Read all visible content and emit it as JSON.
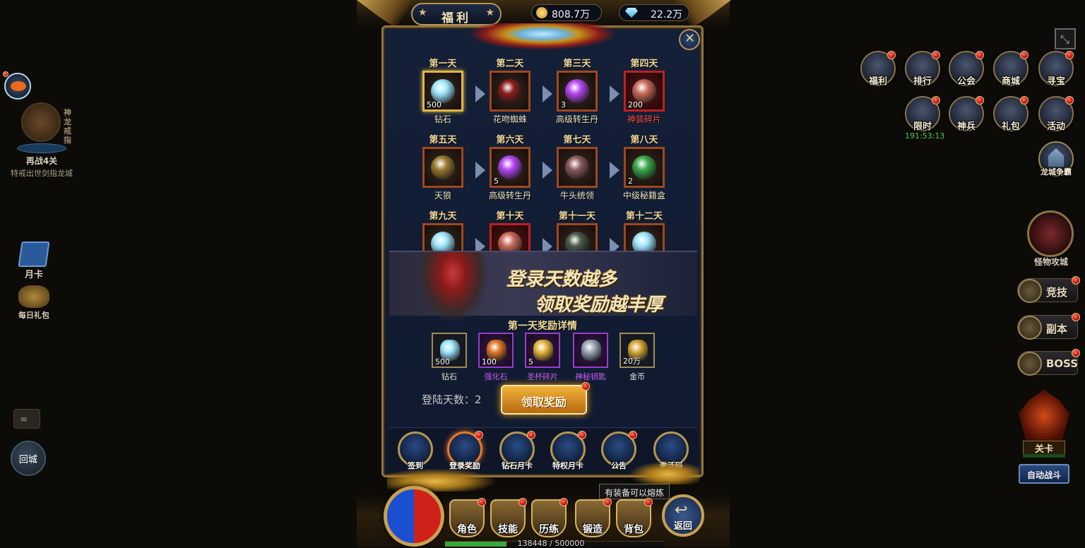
{
  "topbar": {
    "title": "福利",
    "gold": "808.7万",
    "diamonds": "22.2万"
  },
  "left": {
    "boss_side_text": "神龙戒指",
    "boss_level": "再战4关",
    "boss_hint": "特戒出世剑指龙城",
    "month_card": "月卡",
    "daily_gift": "每日礼包",
    "return_city": "回城"
  },
  "right": {
    "row1": [
      "福利",
      "排行",
      "公会",
      "商城",
      "寻宝"
    ],
    "row2": [
      "限时",
      "神兵",
      "礼包",
      "活动"
    ],
    "timer": "191:53:13",
    "dragon_war": "龙城争霸",
    "monster_siege": "怪物攻城",
    "arena": "竞技",
    "dungeon": "副本",
    "boss": "BOSS",
    "stage": "关卡",
    "auto_battle": "自动战斗"
  },
  "days": [
    {
      "title": "第一天",
      "name": "钻石",
      "qty": "500",
      "style": "gold",
      "art": "#9fe6ff"
    },
    {
      "title": "第二天",
      "name": "花吻蜘蛛",
      "qty": "",
      "style": "",
      "art": "#8a1e1e"
    },
    {
      "title": "第三天",
      "name": "高级转生丹",
      "qty": "3",
      "style": "",
      "art": "#b448f0"
    },
    {
      "title": "第四天",
      "name": "神装碎片",
      "qty": "200",
      "style": "red",
      "art": "#c86a5a"
    },
    {
      "title": "第五天",
      "name": "天狼",
      "qty": "",
      "style": "",
      "art": "#9a7a30"
    },
    {
      "title": "第六天",
      "name": "高级转生丹",
      "qty": "5",
      "style": "",
      "art": "#b448f0"
    },
    {
      "title": "第七天",
      "name": "牛头统领",
      "qty": "",
      "style": "",
      "art": "#8a5a5a"
    },
    {
      "title": "第八天",
      "name": "中级秘籍盒",
      "qty": "2",
      "style": "",
      "art": "#3aa84a"
    },
    {
      "title": "第九天",
      "name": "",
      "qty": "",
      "style": "",
      "art": "#9fe6ff"
    },
    {
      "title": "第十天",
      "name": "",
      "qty": "",
      "style": "red",
      "art": "#c86a5a"
    },
    {
      "title": "第十一天",
      "name": "",
      "qty": "",
      "style": "",
      "art": "#4a5a4a"
    },
    {
      "title": "第十二天",
      "name": "",
      "qty": "",
      "style": "",
      "art": "#9fe6ff"
    }
  ],
  "banner": {
    "line1": "登录天数越多",
    "line2": "领取奖励越丰厚"
  },
  "detail": {
    "title": "第一天奖励详情",
    "items": [
      {
        "name": "钻石",
        "qty": "500",
        "style": "",
        "art": "#9fe6ff"
      },
      {
        "name": "强化石",
        "qty": "100",
        "style": "purple",
        "art": "#e07a2a"
      },
      {
        "name": "圣杯碎片",
        "qty": "5",
        "style": "purple",
        "art": "#e8b840"
      },
      {
        "name": "神秘钥匙",
        "qty": "",
        "style": "purple",
        "art": "#9aa8b8"
      },
      {
        "name": "金币",
        "qty": "20万",
        "style": "",
        "art": "#d8a83a"
      }
    ],
    "login_days_label": "登陆天数：",
    "login_days_value": "2",
    "claim_button": "领取奖励"
  },
  "tabs": [
    "签到",
    "登录奖励",
    "钻石月卡",
    "特权月卡",
    "公告",
    "激活码"
  ],
  "tooltip": "有装备可以熔炼",
  "bottom": {
    "buttons": [
      "角色",
      "技能",
      "历练",
      "锻造",
      "背包"
    ],
    "back": "返回",
    "exp": "138448 / 500000"
  }
}
